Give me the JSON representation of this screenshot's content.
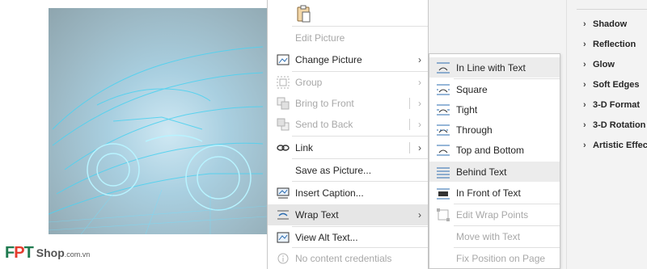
{
  "context_menu": {
    "items": [
      {
        "label": "Edit Picture",
        "icon": "edit-picture-icon",
        "disabled": true
      },
      {
        "label": "Change Picture",
        "icon": "change-picture-icon",
        "disabled": false,
        "submenu": true
      },
      {
        "label": "Group",
        "icon": "group-icon",
        "disabled": true,
        "submenu": true
      },
      {
        "label": "Bring to Front",
        "icon": "bring-to-front-icon",
        "disabled": true,
        "submenu": true
      },
      {
        "label": "Send to Back",
        "icon": "send-to-back-icon",
        "disabled": true,
        "submenu": true
      },
      {
        "label": "Link",
        "icon": "link-icon",
        "disabled": false,
        "submenu": true
      },
      {
        "label": "Save as Picture...",
        "disabled": false
      },
      {
        "label": "Insert Caption...",
        "icon": "insert-caption-icon",
        "disabled": false
      },
      {
        "label": "Wrap Text",
        "icon": "wrap-text-icon",
        "disabled": false,
        "submenu": true,
        "highlighted": true
      },
      {
        "label": "View Alt Text...",
        "icon": "alt-text-icon",
        "disabled": false
      },
      {
        "label": "No content credentials",
        "icon": "info-icon",
        "disabled": true
      }
    ]
  },
  "wrap_submenu": {
    "items": [
      {
        "label": "In Line with Text",
        "icon": "inline-with-text-icon",
        "highlighted": true
      },
      {
        "label": "Square",
        "icon": "square-wrap-icon"
      },
      {
        "label": "Tight",
        "icon": "tight-wrap-icon"
      },
      {
        "label": "Through",
        "icon": "through-wrap-icon"
      },
      {
        "label": "Top and Bottom",
        "icon": "top-bottom-wrap-icon"
      },
      {
        "label": "Behind Text",
        "icon": "behind-text-icon",
        "highlighted": true
      },
      {
        "label": "In Front of Text",
        "icon": "in-front-text-icon"
      },
      {
        "label": "Edit Wrap Points",
        "icon": "edit-wrap-points-icon",
        "disabled": true
      },
      {
        "label": "Move with Text",
        "disabled": true
      },
      {
        "label": "Fix Position on Page",
        "disabled": true
      }
    ]
  },
  "format_pane": {
    "sections": [
      "Shadow",
      "Reflection",
      "Glow",
      "Soft Edges",
      "3-D Format",
      "3-D Rotation",
      "Artistic Effects"
    ]
  },
  "watermark": {
    "brand": "FPT",
    "text": "Shop",
    "suffix": ".com.vn"
  },
  "colors": {
    "accent": "#2b6cb0",
    "highlight": "#e6e6e6",
    "pane_bg": "#f3f3f3",
    "logo_green": "#1f7a4f",
    "logo_red": "#e43b2d"
  }
}
